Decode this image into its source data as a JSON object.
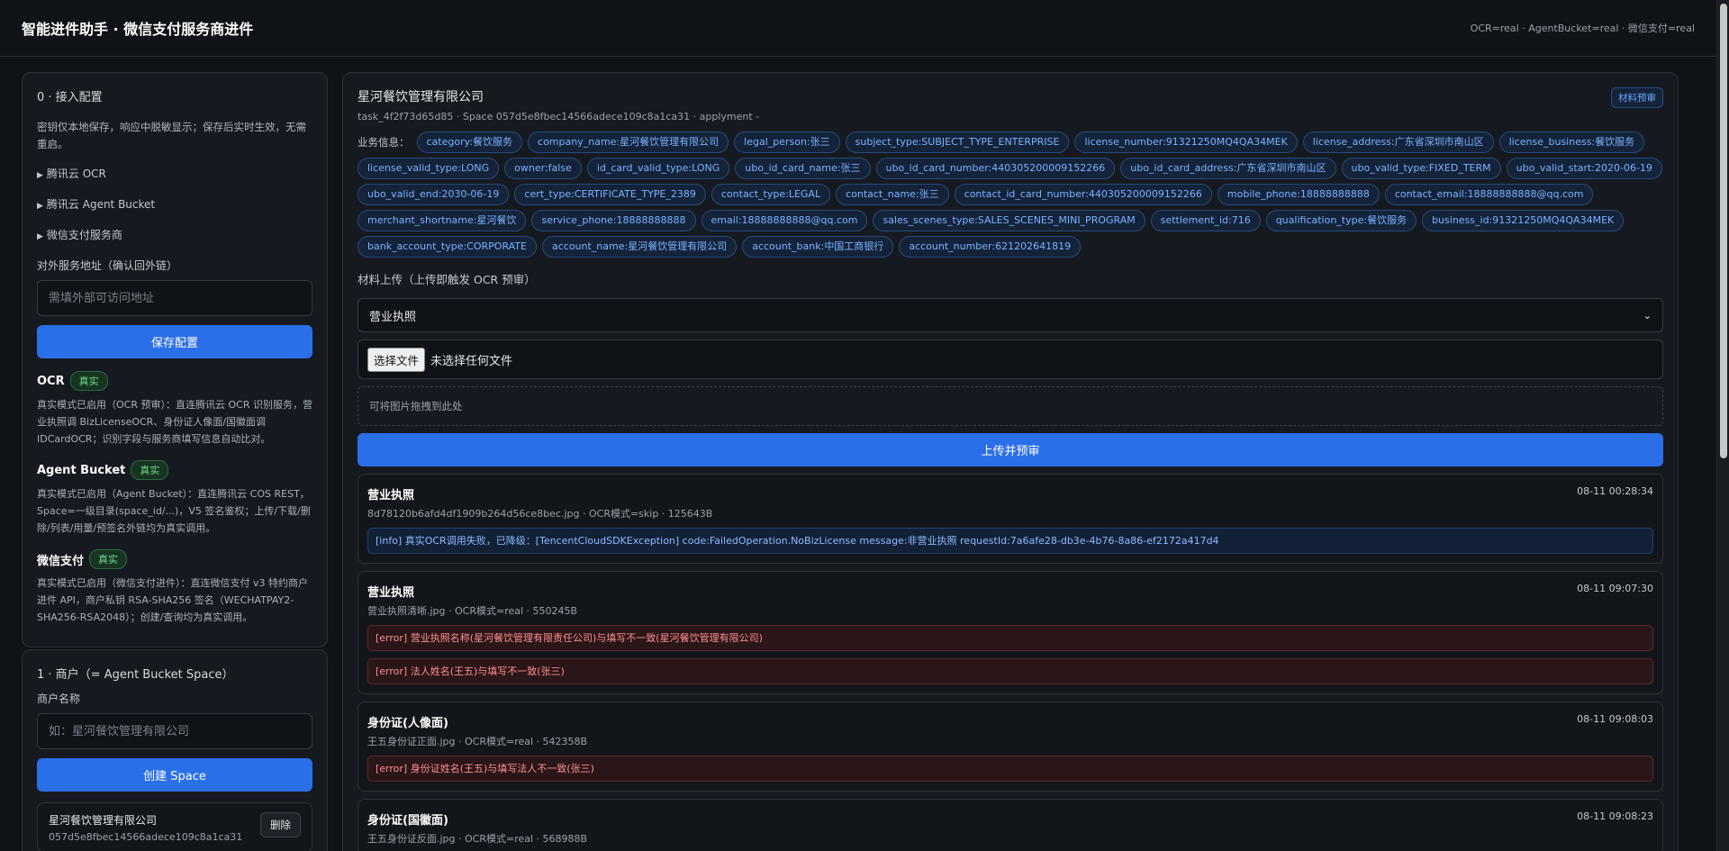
{
  "header": {
    "title": "智能进件助手 · 微信支付服务商进件",
    "status": "OCR=real · AgentBucket=real · 微信支付=real"
  },
  "config": {
    "title": "0 · 接入配置",
    "note": "密钥仅本地保存，响应中脱敏显示；保存后实时生效，无需重启。",
    "expanders": [
      "腾讯云 OCR",
      "腾讯云 Agent Bucket",
      "微信支付服务商"
    ],
    "external_url_label": "对外服务地址（确认回外链）",
    "external_url_placeholder": "需填外部可访问地址",
    "save_label": "保存配置",
    "services": [
      {
        "name": "OCR",
        "badge": "真实",
        "desc": "真实模式已启用（OCR 预审）：直连腾讯云 OCR 识别服务，营业执照调 BizLicenseOCR、身份证人像面/国徽面调 IDCardOCR；识别字段与服务商填写信息自动比对。"
      },
      {
        "name": "Agent Bucket",
        "badge": "真实",
        "desc": "真实模式已启用（Agent Bucket）：直连腾讯云 COS REST，Space=一级目录(space_id/...)，V5 签名鉴权；上传/下载/删除/列表/用量/预签名外链均为真实调用。"
      },
      {
        "name": "微信支付",
        "badge": "真实",
        "desc": "真实模式已启用（微信支付进件）：直连微信支付 v3 特约商户进件 API，商户私钥 RSA-SHA256 签名（WECHATPAY2-SHA256-RSA2048）；创建/查询均为真实调用。"
      }
    ]
  },
  "merchant": {
    "title": "1 · 商户（= Agent Bucket Space）",
    "name_label": "商户名称",
    "name_placeholder": "如：星河餐饮管理有限公司",
    "create_label": "创建 Space",
    "spaces": [
      {
        "name": "星河餐饮管理有限公司",
        "id": "057d5e8fbec14566adece109c8a1ca31",
        "delete_label": "删除"
      }
    ]
  },
  "main": {
    "company": "星河餐饮管理有限公司",
    "task_meta": "task_4f2f73d65d85 · Space 057d5e8fbec14566adece109c8a1ca31 · applyment -",
    "preview_label": "材料预审",
    "biz_label": "业务信息：",
    "tags": [
      "category:餐饮服务",
      "company_name:星河餐饮管理有限公司",
      "legal_person:张三",
      "subject_type:SUBJECT_TYPE_ENTERPRISE",
      "license_number:91321250MQ4QA34MEK",
      "license_address:广东省深圳市南山区",
      "license_business:餐饮服务",
      "license_valid_type:LONG",
      "owner:false",
      "id_card_valid_type:LONG",
      "ubo_id_card_name:张三",
      "ubo_id_card_number:440305200009152266",
      "ubo_id_card_address:广东省深圳市南山区",
      "ubo_valid_type:FIXED_TERM",
      "ubo_valid_start:2020-06-19",
      "ubo_valid_end:2030-06-19",
      "cert_type:CERTIFICATE_TYPE_2389",
      "contact_type:LEGAL",
      "contact_name:张三",
      "contact_id_card_number:440305200009152266",
      "mobile_phone:18888888888",
      "contact_email:18888888888@qq.com",
      "merchant_shortname:星河餐饮",
      "service_phone:18888888888",
      "email:18888888888@qq.com",
      "sales_scenes_type:SALES_SCENES_MINI_PROGRAM",
      "settlement_id:716",
      "qualification_type:餐饮服务",
      "business_id:91321250MQ4QA34MEK",
      "bank_account_type:CORPORATE",
      "account_name:星河餐饮管理有限公司",
      "account_bank:中国工商银行",
      "account_number:621202641819"
    ],
    "upload_title": "材料上传（上传即触发 OCR 预审）",
    "doc_type_selected": "营业执照",
    "file_button": "选择文件",
    "file_status": "未选择任何文件",
    "drop_hint": "可将图片拖拽到此处",
    "upload_button": "上传并预审",
    "results": [
      {
        "title": "营业执照",
        "time": "08-11 00:28:34",
        "meta": "8d78120b6afd4df1909b264d56ce8bec.jpg · OCR模式=skip · 125643B",
        "messages": [
          {
            "level": "info",
            "text": "[info] 真实OCR调用失败，已降级：[TencentCloudSDKException] code:FailedOperation.NoBizLicense message:非营业执照 requestId:7a6afe28-db3e-4b76-8a86-ef2172a417d4"
          }
        ]
      },
      {
        "title": "营业执照",
        "time": "08-11 09:07:30",
        "meta": "营业执照清晰.jpg · OCR模式=real · 550245B",
        "messages": [
          {
            "level": "error",
            "text": "[error] 营业执照名称(星河餐饮管理有限责任公司)与填写不一致(星河餐饮管理有限公司)"
          },
          {
            "level": "error",
            "text": "[error] 法人姓名(王五)与填写不一致(张三)"
          }
        ]
      },
      {
        "title": "身份证(人像面)",
        "time": "08-11 09:08:03",
        "meta": "王五身份证正面.jpg · OCR模式=real · 542358B",
        "messages": [
          {
            "level": "error",
            "text": "[error] 身份证姓名(王五)与填写法人不一致(张三)"
          }
        ]
      },
      {
        "title": "身份证(国徽面)",
        "time": "08-11 09:08:23",
        "meta": "王五身份证反面.jpg · OCR模式=real · 568988B",
        "messages": []
      }
    ]
  }
}
